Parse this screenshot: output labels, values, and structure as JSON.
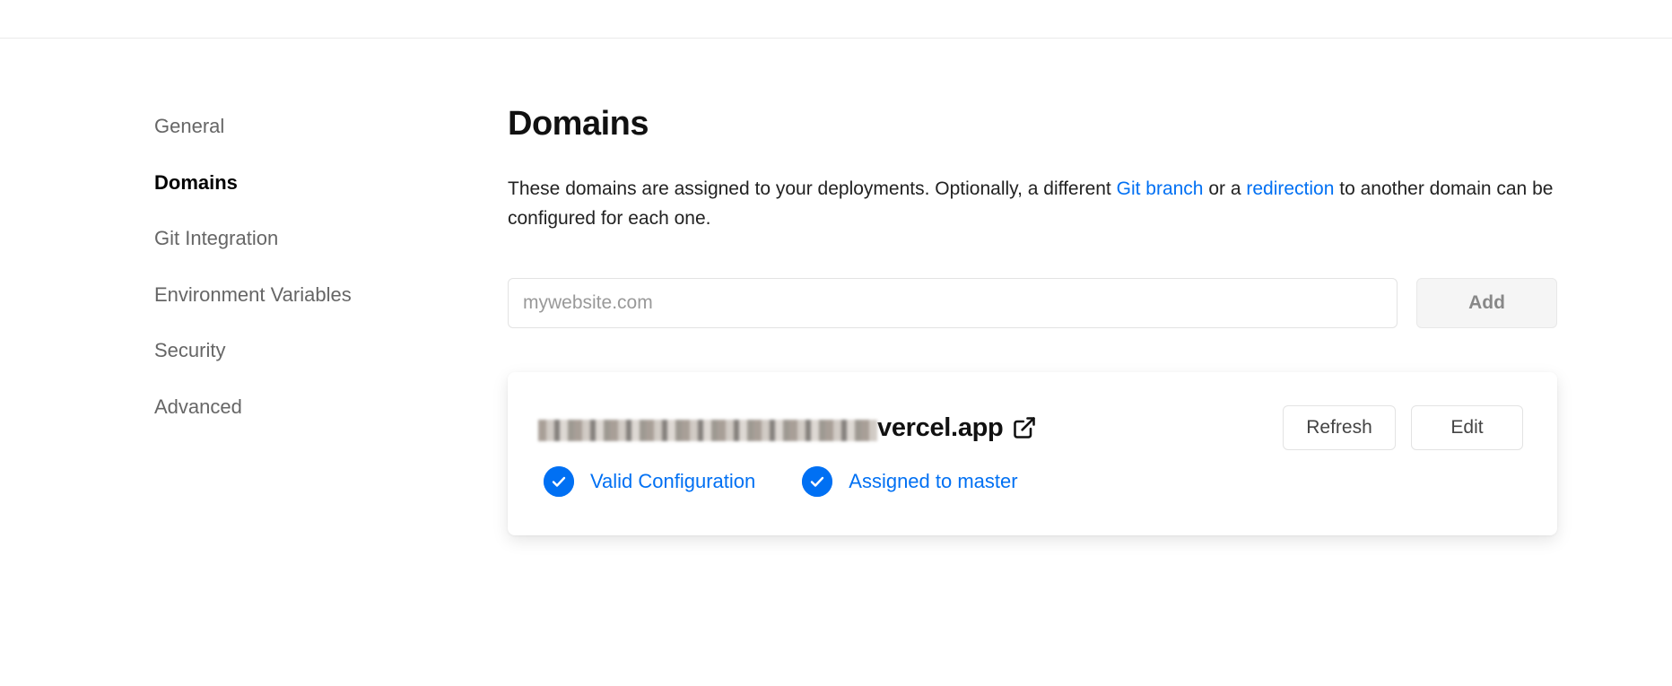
{
  "sidebar": {
    "items": [
      {
        "label": "General",
        "active": false
      },
      {
        "label": "Domains",
        "active": true
      },
      {
        "label": "Git Integration",
        "active": false
      },
      {
        "label": "Environment Variables",
        "active": false
      },
      {
        "label": "Security",
        "active": false
      },
      {
        "label": "Advanced",
        "active": false
      }
    ]
  },
  "main": {
    "title": "Domains",
    "description": {
      "part1": "These domains are assigned to your deployments. Optionally, a different ",
      "link1": "Git branch",
      "part2": " or a ",
      "link2": "redirection",
      "part3": " to another domain can be configured for each one."
    },
    "add_domain": {
      "placeholder": "mywebsite.com",
      "value": "",
      "button_label": "Add"
    },
    "domain_card": {
      "domain_suffix": "vercel.app",
      "external_link_icon": "external-link-icon",
      "refresh_label": "Refresh",
      "edit_label": "Edit",
      "statuses": [
        {
          "label": "Valid Configuration",
          "icon": "check-circle-icon"
        },
        {
          "label": "Assigned to master",
          "icon": "check-circle-icon"
        }
      ]
    }
  },
  "colors": {
    "accent": "#0070f3",
    "muted_text": "#666666",
    "border": "#e3e3e3"
  }
}
